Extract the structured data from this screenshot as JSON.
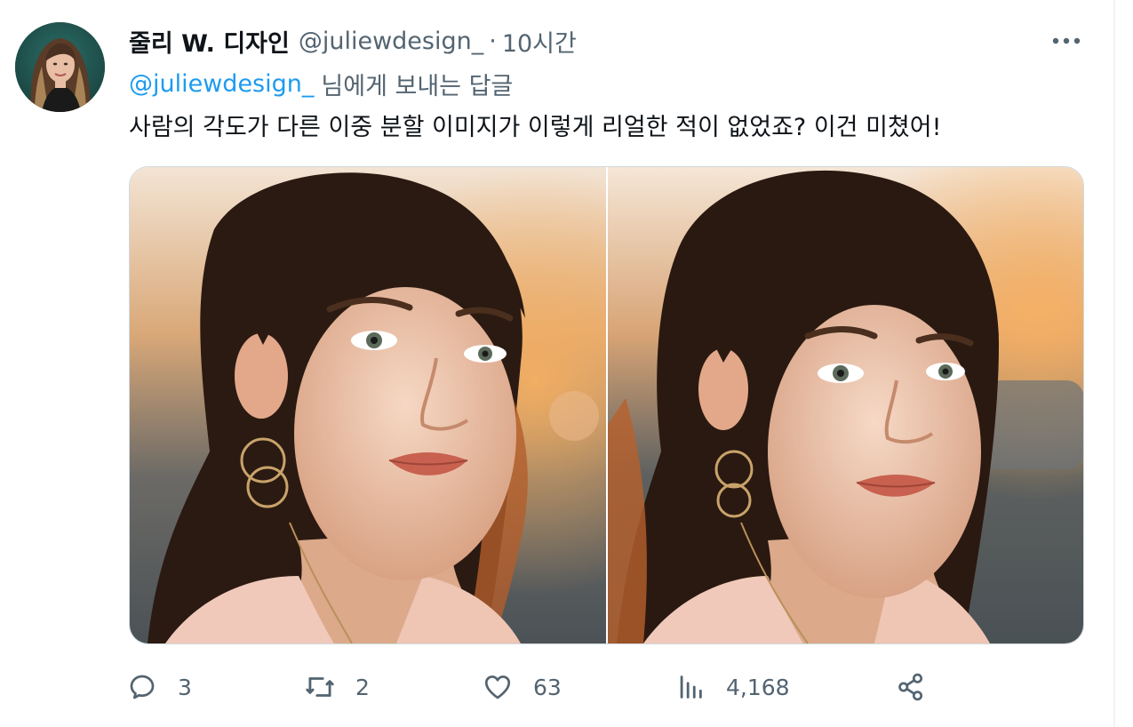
{
  "tweet": {
    "display_name": "줄리 W. 디자인",
    "handle": "@juliewdesign_",
    "separator": "·",
    "time": "10시간",
    "replying_to_handle": "@juliewdesign_",
    "replying_to_suffix": "님에게 보내는 답글",
    "text": "사람의 각도가 다른 이중 분할 이미지가 이렇게 리얼한 적이 없었죠? 이건 미쳤어!",
    "avatar_icon": "avatar-photo",
    "more_icon": "more-dots-icon"
  },
  "media": {
    "images": [
      {
        "icon": "portrait-photo-left"
      },
      {
        "icon": "portrait-photo-right"
      }
    ]
  },
  "actions": {
    "reply": {
      "icon": "reply-icon",
      "count": "3"
    },
    "retweet": {
      "icon": "retweet-icon",
      "count": "2"
    },
    "like": {
      "icon": "heart-icon",
      "count": "63"
    },
    "views": {
      "icon": "views-icon",
      "count": "4,168"
    },
    "share": {
      "icon": "share-icon"
    }
  },
  "colors": {
    "text_primary": "#0f1419",
    "text_secondary": "#536471",
    "link": "#1d9bf0",
    "border": "#cfd9de"
  }
}
